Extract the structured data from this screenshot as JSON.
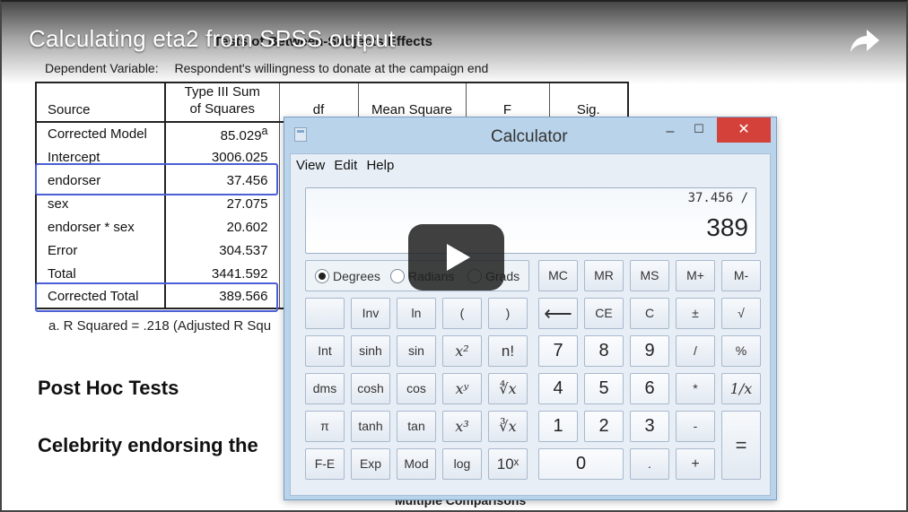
{
  "video": {
    "title": "Calculating eta2 from SPSS output",
    "share_icon": "share-arrow-icon",
    "play_icon": "play-icon"
  },
  "spss": {
    "heading": "Tests of Between-Subjects Effects",
    "dependent_label": "Dependent Variable:",
    "dependent_value": "Respondent's willingness to donate at the campaign end",
    "columns": {
      "source": "Source",
      "ss_line1": "Type III Sum",
      "ss_line2": "of Squares",
      "df": "df",
      "ms": "Mean Square",
      "f": "F",
      "sig": "Sig."
    },
    "rows": [
      {
        "source": "Corrected Model",
        "ss": "85.029",
        "sup": "a"
      },
      {
        "source": "Intercept",
        "ss": "3006.025",
        "sup": ""
      },
      {
        "source": "endorser",
        "ss": "37.456",
        "sup": ""
      },
      {
        "source": "sex",
        "ss": "27.075",
        "sup": ""
      },
      {
        "source": "endorser * sex",
        "ss": "20.602",
        "sup": ""
      },
      {
        "source": "Error",
        "ss": "304.537",
        "sup": ""
      },
      {
        "source": "Total",
        "ss": "3441.592",
        "sup": ""
      },
      {
        "source": "Corrected Total",
        "ss": "389.566",
        "sup": ""
      }
    ],
    "footnote": "a. R Squared = .218 (Adjusted R Squ",
    "post_hoc": "Post Hoc Tests",
    "celebrity": "Celebrity endorsing the",
    "multiple": "Multiple Comparisons"
  },
  "calculator": {
    "title": "Calculator",
    "menu": [
      "View",
      "Edit",
      "Help"
    ],
    "display_expression": "37.456 /",
    "display_value": "389",
    "angle_modes": [
      "Degrees",
      "Radians",
      "Grads"
    ],
    "selected_angle": "Degrees",
    "buttons": {
      "mc": "MC",
      "mr": "MR",
      "ms": "MS",
      "mplus": "M+",
      "mminus": "M-",
      "inv": "Inv",
      "ln": "ln",
      "lparen": "(",
      "rparen": ")",
      "back": "⟵",
      "ce": "CE",
      "c": "C",
      "plusminus": "±",
      "sqrt": "√",
      "int": "Int",
      "sinh": "sinh",
      "sin": "sin",
      "x2": "x²",
      "nfact": "n!",
      "n7": "7",
      "n8": "8",
      "n9": "9",
      "div": "/",
      "pct": "%",
      "dms": "dms",
      "cosh": "cosh",
      "cos": "cos",
      "xy": "xʸ",
      "yroot": "∜x",
      "n4": "4",
      "n5": "5",
      "n6": "6",
      "mul": "*",
      "recip": "1/x",
      "pi": "π",
      "tanh": "tanh",
      "tan": "tan",
      "x3": "x³",
      "cuberoot": "∛x",
      "n1": "1",
      "n2": "2",
      "n3": "3",
      "minus": "-",
      "equals": "=",
      "fe": "F-E",
      "exp": "Exp",
      "mod": "Mod",
      "log": "log",
      "tenx": "10ˣ",
      "n0": "0",
      "dot": ".",
      "plus": "+"
    }
  }
}
